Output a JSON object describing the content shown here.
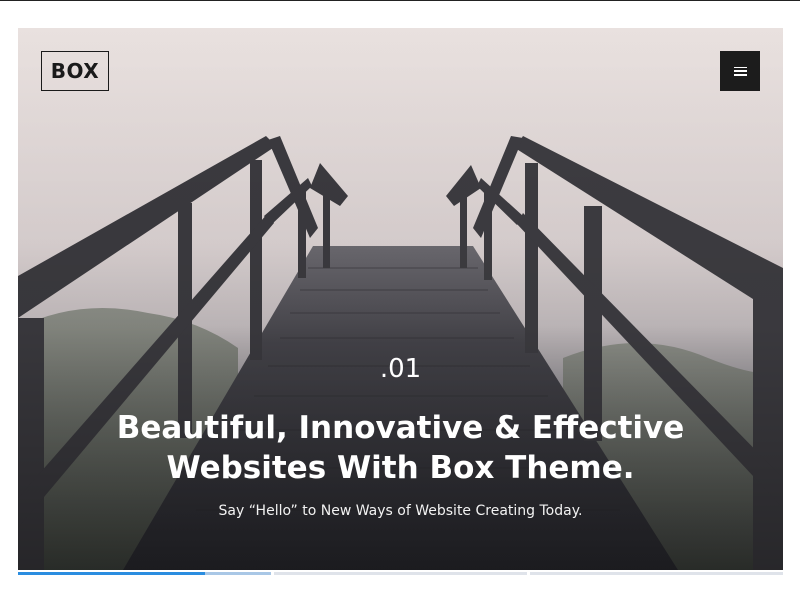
{
  "header": {
    "logo_text": "BOX",
    "menu_icon": "hamburger-menu-icon"
  },
  "slide": {
    "number": ".01",
    "headline_line1": "Beautiful, Innovative & Effective",
    "headline_line2": "Websites With Box Theme.",
    "subtitle": "Say “Hello” to New Ways of Website Creating Today."
  },
  "slider_progress": {
    "active_index": 0,
    "slides": [
      {
        "progress": 0.74
      },
      {
        "progress": 0.0
      },
      {
        "progress": 0.0
      }
    ]
  },
  "colors": {
    "accent": "#2a8de0",
    "accent_light": "#a9c7e6",
    "track": "#dfe3ea",
    "menu_button_bg": "#1c1c1c",
    "logo_border": "#1a1a1a"
  }
}
